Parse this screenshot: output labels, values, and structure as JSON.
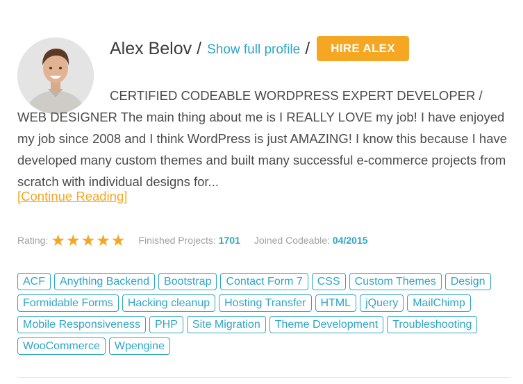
{
  "profile": {
    "name": "Alex Belov",
    "separator": "/",
    "show_profile_link": "Show full profile",
    "hire_label": "HIRE ALEX",
    "bio": "CERTIFIED CODEABLE WORDPRESS EXPERT DEVELOPER / WEB DESIGNER The main thing about me is I REALLY LOVE my job! I have enjoyed my job since 2008 and I think WordPress is just AMAZING! I know this because I have developed many custom themes and built many successful e-commerce projects from scratch with individual designs for...",
    "continue_label": "[Continue Reading]"
  },
  "stats": {
    "rating_label": "Rating:",
    "rating_value": 5,
    "rating_max": 5,
    "projects_label": "Finished Projects:",
    "projects_value": "1701",
    "joined_label": "Joined Codeable:",
    "joined_value": "04/2015"
  },
  "tags": [
    "ACF",
    "Anything Backend",
    "Bootstrap",
    "Contact Form 7",
    "CSS",
    "Custom Themes",
    "Design",
    "Formidable Forms",
    "Hacking cleanup",
    "Hosting Transfer",
    "HTML",
    "jQuery",
    "MailChimp",
    "Mobile Responsiveness",
    "PHP",
    "Site Migration",
    "Theme Development",
    "Troubleshooting",
    "WooCommerce",
    "Wpengine"
  ],
  "colors": {
    "accent_blue": "#2da6c6",
    "accent_orange": "#f5a623",
    "text": "#4a4a4a",
    "muted": "#a0a0a0"
  }
}
